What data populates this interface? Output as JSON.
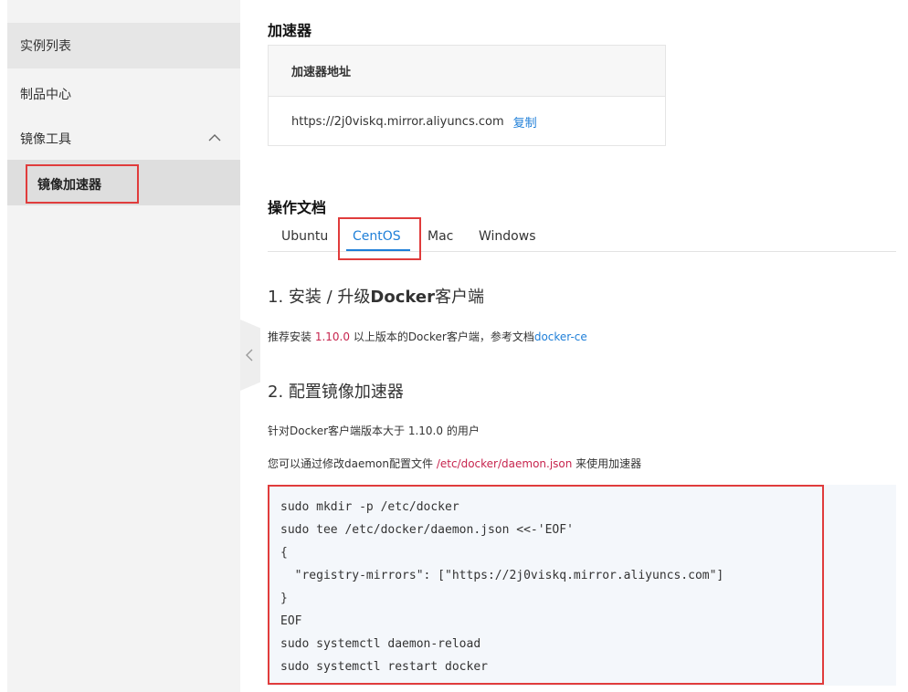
{
  "sidebar": {
    "items": [
      {
        "label": "实例列表"
      },
      {
        "label": "制品中心"
      },
      {
        "label": "镜像工具"
      }
    ],
    "sub_item": {
      "label": "镜像加速器"
    }
  },
  "accelerator": {
    "section_title": "加速器",
    "table_header": "加速器地址",
    "address": "https://2j0viskq.mirror.aliyuncs.com",
    "copy_label": "复制"
  },
  "docs": {
    "section_title": "操作文档",
    "tabs": [
      {
        "label": "Ubuntu"
      },
      {
        "label": "CentOS"
      },
      {
        "label": "Mac"
      },
      {
        "label": "Windows"
      }
    ],
    "active_tab": "CentOS"
  },
  "step1": {
    "prefix": "1. 安装 / 升级",
    "bold": "Docker",
    "suffix": "客户端",
    "para_pre": "推荐安装 ",
    "version": "1.10.0",
    "para_mid": " 以上版本的Docker客户端，参考文档",
    "link": "docker-ce"
  },
  "step2": {
    "title": "2. 配置镜像加速器",
    "para1": "针对Docker客户端版本大于 1.10.0 的用户",
    "para2_pre": "您可以通过修改daemon配置文件 ",
    "config_path": "/etc/docker/daemon.json",
    "para2_post": " 来使用加速器"
  },
  "code": {
    "lines": [
      "sudo mkdir -p /etc/docker",
      "sudo tee /etc/docker/daemon.json <<-'EOF'",
      "{",
      "  \"registry-mirrors\": [\"https://2j0viskq.mirror.aliyuncs.com\"]",
      "}",
      "EOF",
      "sudo systemctl daemon-reload",
      "sudo systemctl restart docker"
    ]
  },
  "colors": {
    "accent": "#1f7fd8",
    "highlight": "#e03c3c",
    "code_red": "#c7254e"
  }
}
